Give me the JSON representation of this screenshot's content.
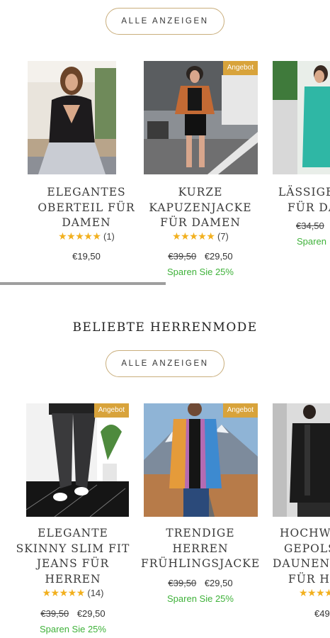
{
  "women_section": {
    "show_all_label": "ALLE ANZEIGEN",
    "products": [
      {
        "title_lines": [
          "ELEGANTES",
          "OBERTEIL FÜR",
          "DAMEN"
        ],
        "rating_count": "(1)",
        "old_price": "",
        "price": "€19,50",
        "savings": "",
        "badge": ""
      },
      {
        "title_lines": [
          "KURZE",
          "KAPUZENJACKE",
          "FÜR DAMEN"
        ],
        "rating_count": "(7)",
        "old_price": "€39,50",
        "price": "€29,50",
        "savings": "Sparen Sie 25%",
        "badge": "Angebot"
      },
      {
        "title_lines": [
          "LÄSSIGE",
          "FÜR DA"
        ],
        "rating_count": "",
        "old_price": "€34,50",
        "price": "",
        "savings": "Sparen",
        "badge": ""
      }
    ]
  },
  "men_section": {
    "heading": "BELIEBTE HERRENMODE",
    "show_all_label": "ALLE ANZEIGEN",
    "products": [
      {
        "title_lines": [
          "ELEGANTE",
          "SKINNY SLIM FIT",
          "JEANS FÜR",
          "HERREN"
        ],
        "rating_count": "(14)",
        "old_price": "€39,50",
        "price": "€29,50",
        "savings": "Sparen Sie 25%",
        "badge": "Angebot"
      },
      {
        "title_lines": [
          "TRENDIGE",
          "HERREN",
          "FRÜHLINGSJACKE"
        ],
        "rating_count": "",
        "old_price": "€39,50",
        "price": "€29,50",
        "savings": "Sparen Sie 25%",
        "badge": "Angebot"
      },
      {
        "title_lines": [
          "HOCHW",
          "GEPOLS",
          "DAUNENW",
          "FÜR HE"
        ],
        "rating_count": "",
        "old_price": "",
        "price": "€49",
        "savings": "",
        "badge": ""
      }
    ]
  },
  "stars": "★★★★★",
  "colors": {
    "accent_gold": "#c9ae7c",
    "badge": "#d8a33b",
    "star": "#f2b01e",
    "savings_green": "#3fb23a"
  }
}
